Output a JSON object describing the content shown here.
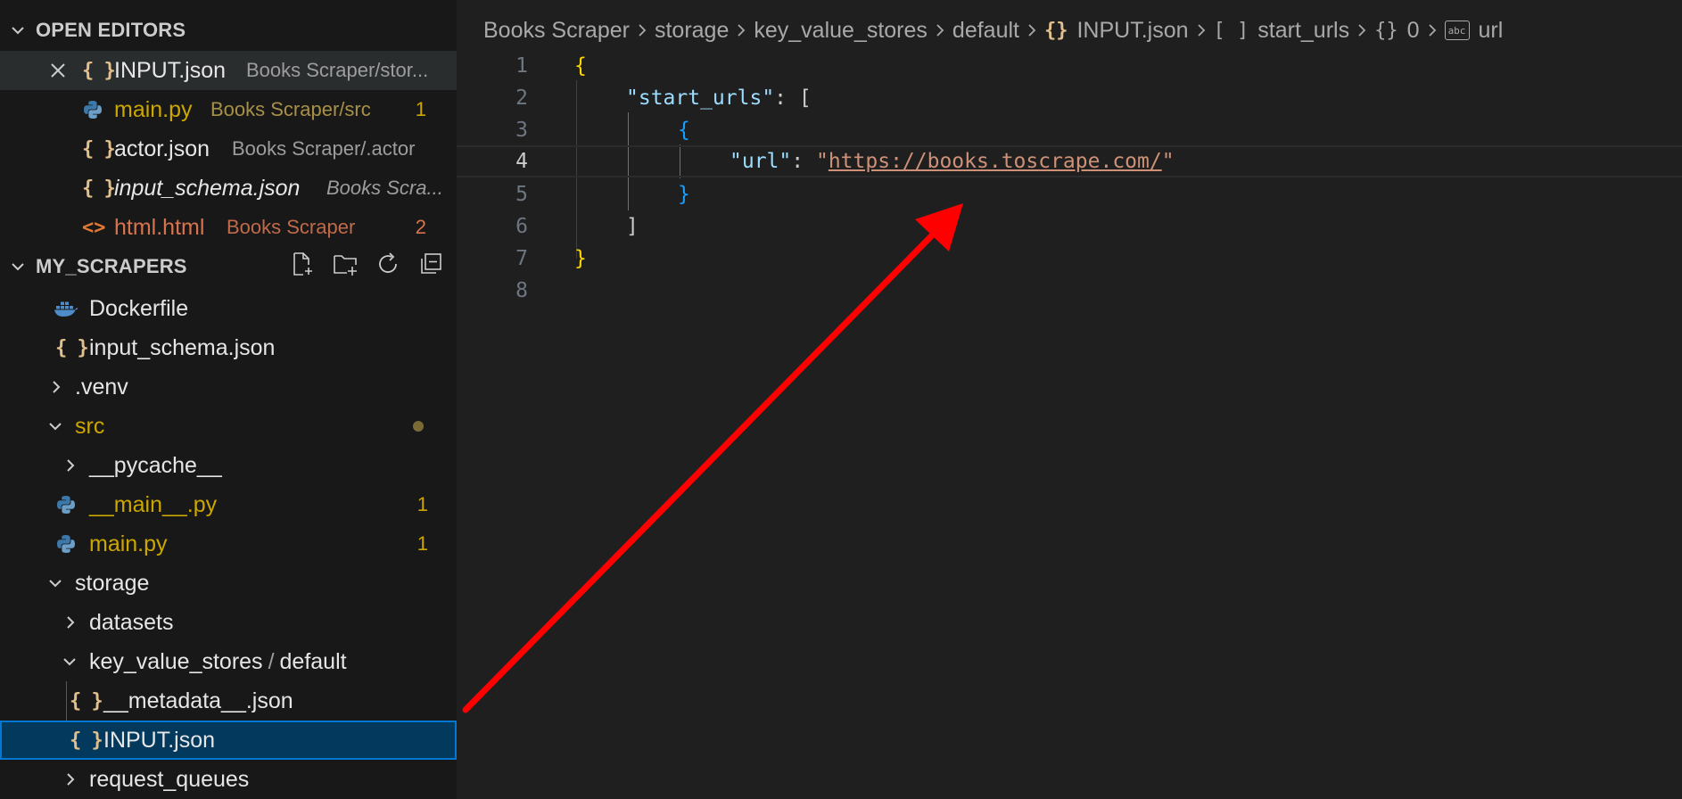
{
  "open_editors": {
    "title": "OPEN EDITORS",
    "items": [
      {
        "name": "INPUT.json",
        "desc": "Books Scraper/stor..."
      },
      {
        "name": "main.py",
        "desc": "Books Scraper/src",
        "badge": "1"
      },
      {
        "name": "actor.json",
        "desc": "Books Scraper/.actor"
      },
      {
        "name": "input_schema.json",
        "desc": "Books Scra..."
      },
      {
        "name": "html.html",
        "desc": "Books Scraper",
        "badge": "2"
      }
    ]
  },
  "explorer": {
    "title": "MY_SCRAPERS",
    "items": {
      "dockerfile": "Dockerfile",
      "input_schema": "input_schema.json",
      "venv": ".venv",
      "src": "src",
      "pycache": "__pycache__",
      "dunder_main": "__main__.py",
      "dunder_main_badge": "1",
      "main_py": "main.py",
      "main_py_badge": "1",
      "storage": "storage",
      "datasets": "datasets",
      "kvs": "key_value_stores",
      "kvs_sep": "/",
      "kvs_default": "default",
      "metadata": "__metadata__.json",
      "input_json": "INPUT.json",
      "request_queues": "request_queues"
    }
  },
  "breadcrumbs": {
    "items": [
      "Books Scraper",
      "storage",
      "key_value_stores",
      "default",
      "INPUT.json",
      "start_urls",
      "0",
      "url"
    ],
    "icons": {
      "INPUT.json": "{}",
      "start_urls": "[ ]",
      "0": "{}",
      "url": "abc"
    }
  },
  "editor": {
    "line_numbers": [
      "1",
      "2",
      "3",
      "4",
      "5",
      "6",
      "7",
      "8"
    ],
    "active_line": "4",
    "tokens": {
      "open_brace": "{",
      "start_urls_key": "\"start_urls\"",
      "colon": ":",
      "open_bracket": "[",
      "inner_open": "{",
      "url_key": "\"url\"",
      "quote_open": "\"",
      "url_value": "https://books.toscrape.com/",
      "quote_close": "\"",
      "inner_close": "}",
      "close_bracket": "]",
      "close_brace": "}"
    }
  },
  "annotation": {
    "arrow_color": "#ff0000"
  },
  "colors": {
    "selection_bg": "#04395e",
    "selection_border": "#0078d4",
    "sidebar_bg": "#181818",
    "editor_bg": "#1f1f1f"
  }
}
